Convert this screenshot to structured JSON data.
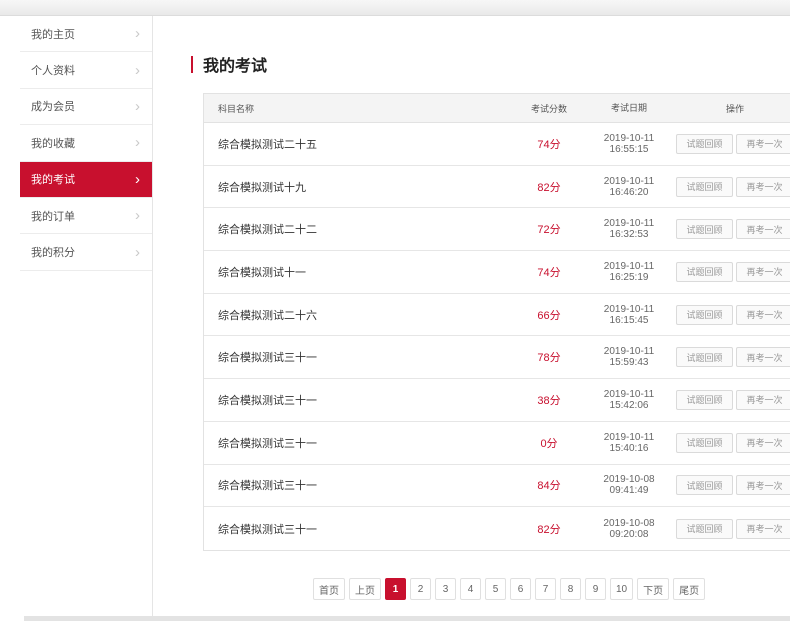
{
  "sidebar": {
    "items": [
      {
        "label": "我的主页",
        "active": false
      },
      {
        "label": "个人资料",
        "active": false
      },
      {
        "label": "成为会员",
        "active": false
      },
      {
        "label": "我的收藏",
        "active": false
      },
      {
        "label": "我的考试",
        "active": true
      },
      {
        "label": "我的订单",
        "active": false
      },
      {
        "label": "我的积分",
        "active": false
      }
    ]
  },
  "main": {
    "title": "我的考试",
    "table": {
      "headers": {
        "name": "科目名称",
        "score": "考试分数",
        "date": "考试日期",
        "op": "操作"
      },
      "rows": [
        {
          "name": "综合模拟测试二十五",
          "score": "74分",
          "date": "2019-10-11",
          "time": "16:55:15",
          "review": "试题回顾",
          "retry": "再考一次"
        },
        {
          "name": "综合模拟测试十九",
          "score": "82分",
          "date": "2019-10-11",
          "time": "16:46:20",
          "review": "试题回顾",
          "retry": "再考一次"
        },
        {
          "name": "综合模拟测试二十二",
          "score": "72分",
          "date": "2019-10-11",
          "time": "16:32:53",
          "review": "试题回顾",
          "retry": "再考一次"
        },
        {
          "name": "综合模拟测试十一",
          "score": "74分",
          "date": "2019-10-11",
          "time": "16:25:19",
          "review": "试题回顾",
          "retry": "再考一次"
        },
        {
          "name": "综合模拟测试二十六",
          "score": "66分",
          "date": "2019-10-11",
          "time": "16:15:45",
          "review": "试题回顾",
          "retry": "再考一次"
        },
        {
          "name": "综合模拟测试三十一",
          "score": "78分",
          "date": "2019-10-11",
          "time": "15:59:43",
          "review": "试题回顾",
          "retry": "再考一次"
        },
        {
          "name": "综合模拟测试三十一",
          "score": "38分",
          "date": "2019-10-11",
          "time": "15:42:06",
          "review": "试题回顾",
          "retry": "再考一次"
        },
        {
          "name": "综合模拟测试三十一",
          "score": "0分",
          "date": "2019-10-11",
          "time": "15:40:16",
          "review": "试题回顾",
          "retry": "再考一次"
        },
        {
          "name": "综合模拟测试三十一",
          "score": "84分",
          "date": "2019-10-08",
          "time": "09:41:49",
          "review": "试题回顾",
          "retry": "再考一次"
        },
        {
          "name": "综合模拟测试三十一",
          "score": "82分",
          "date": "2019-10-08",
          "time": "09:20:08",
          "review": "试题回顾",
          "retry": "再考一次"
        }
      ]
    },
    "pagination": {
      "first": "首页",
      "prev": "上页",
      "pages": [
        "1",
        "2",
        "3",
        "4",
        "5",
        "6",
        "7",
        "8",
        "9",
        "10"
      ],
      "current": "1",
      "next": "下页",
      "last": "尾页"
    }
  },
  "colors": {
    "accent": "#c8102e",
    "border": "#e2e2e2",
    "header_bg": "#f4f4f4"
  }
}
